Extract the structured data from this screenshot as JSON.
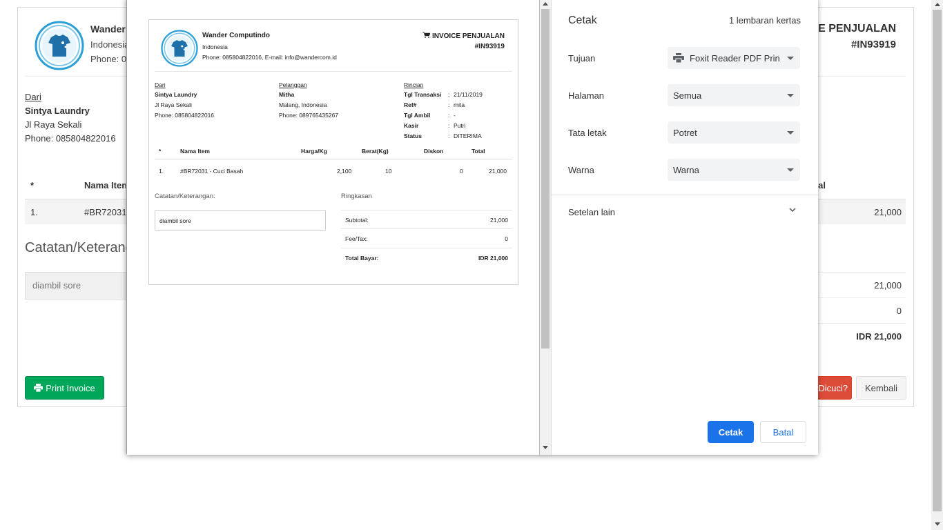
{
  "background": {
    "company": "Wander",
    "country": "Indonesia",
    "phone": "Phone: 08",
    "invoice_title": "ICE PENJUALAN",
    "invoice_number": "#IN93919",
    "from_label": "Dari",
    "from_name": "Sintya Laundry",
    "from_address": "Jl Raya Sekali",
    "from_phone": "Phone: 085804822016",
    "table_headers": {
      "no": "*",
      "name": "Nama Item",
      "total": "al"
    },
    "row": {
      "no": "1.",
      "name": "#BR72031",
      "total": "21,000"
    },
    "notes_title": "Catatan/Keterangan:",
    "notes_value": "diambil sore",
    "subtotal": "21,000",
    "fee": "0",
    "grand_total": "IDR 21,000",
    "print_button": "Print Invoice",
    "washed_button": "Dicuci?",
    "back_button": "Kembali"
  },
  "preview": {
    "company": "Wander Computindo",
    "country": "Indonesia",
    "contact": "Phone: 085804822016, E-mail: info@wandercom.id",
    "invoice_title": "INVOICE PENJUALAN",
    "invoice_number": "#IN93919",
    "from": {
      "label": "Dari",
      "name": "Sintya Laundry",
      "address": "Jl Raya Sekali",
      "phone": "Phone: 085804822016"
    },
    "customer": {
      "label": "Pelanggan",
      "name": "Mitha",
      "address": "Malang, Indonesia",
      "phone": "Phone: 089765435267"
    },
    "details": {
      "label": "Rincian",
      "rows": [
        {
          "key": "Tgl Transaksi",
          "value": "21/11/2019"
        },
        {
          "key": "Ref#",
          "value": "mita"
        },
        {
          "key": "Tgl Ambil",
          "value": "-"
        },
        {
          "key": "Kasir",
          "value": "Putri"
        },
        {
          "key": "Status",
          "value": "DITERIMA"
        }
      ]
    },
    "table": {
      "headers": [
        "*",
        "Nama Item",
        "Harga/Kg",
        "Berat(Kg)",
        "Diskon",
        "Total"
      ],
      "row": [
        "1.",
        "#BR72031 - Cuci Basah",
        "2,100",
        "10",
        "0",
        "21,000"
      ]
    },
    "notes_label": "Catatan/Keterangan:",
    "notes_value": "diambil sore",
    "summary_label": "Ringkasan",
    "summary": [
      {
        "key": "Subtotal:",
        "value": "21,000"
      },
      {
        "key": "Fee/Tax:",
        "value": "0"
      },
      {
        "key": "Total Bayar:",
        "value": "IDR 21,000"
      }
    ]
  },
  "print_settings": {
    "title": "Cetak",
    "sheet_count": "1 lembaran kertas",
    "destination_label": "Tujuan",
    "destination_value": "Foxit Reader PDF Printer",
    "pages_label": "Halaman",
    "pages_value": "Semua",
    "layout_label": "Tata letak",
    "layout_value": "Potret",
    "color_label": "Warna",
    "color_value": "Warna",
    "more_settings": "Setelan lain",
    "print_button": "Cetak",
    "cancel_button": "Batal"
  },
  "colors": {
    "green_button": "#00a65a",
    "red_button": "#dd4b39",
    "primary_blue": "#1a73e8",
    "logo_blue": "#2a9fd6"
  },
  "icons": [
    "tshirt-logo-icon",
    "cart-icon",
    "printer-icon",
    "chevron-down-icon",
    "dropdown-arrow-icon"
  ]
}
